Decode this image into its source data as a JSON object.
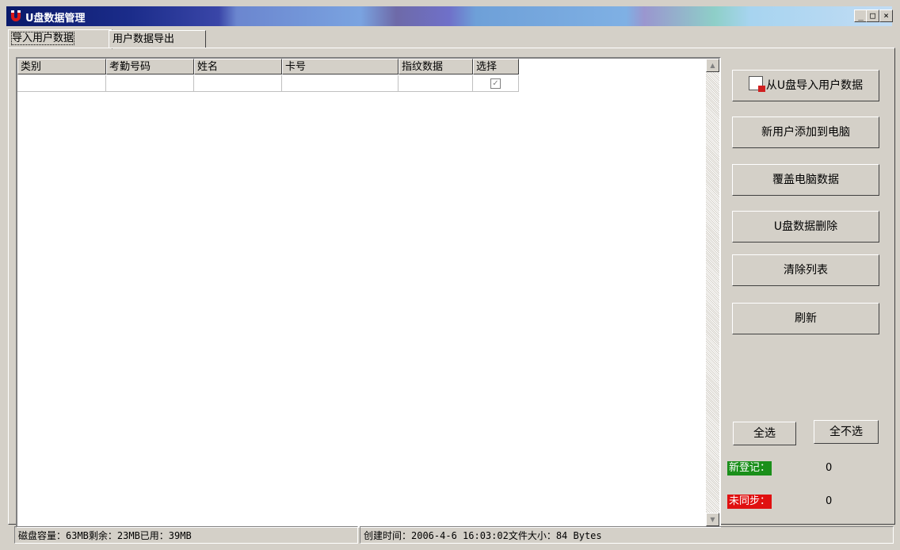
{
  "window": {
    "title": "U盘数据管理",
    "minimize": "_",
    "maximize": "□",
    "close": "×"
  },
  "tabs": [
    {
      "label": "导入用户数据",
      "active": true
    },
    {
      "label": "用户数据导出",
      "active": false
    }
  ],
  "table": {
    "columns": [
      "类别",
      "考勤号码",
      "姓名",
      "卡号",
      "指纹数据",
      "选择"
    ],
    "rows": [
      {
        "category": "",
        "attendance_no": "",
        "name": "",
        "card_no": "",
        "fingerprint": "",
        "selected": true
      }
    ]
  },
  "actions": {
    "import": "从U盘导入用户数据",
    "add_new": "新用户添加到电脑",
    "overwrite": "覆盖电脑数据",
    "delete_u": "U盘数据删除",
    "clear_list": "清除列表",
    "refresh": "刷新"
  },
  "selection": {
    "select_all": "全选",
    "select_none": "全不选"
  },
  "counters": {
    "new_label": "新登记：",
    "new_value": "0",
    "new_color": "#1a8f1a",
    "unsync_label": "未同步：",
    "unsync_value": "0",
    "unsync_color": "#e01010"
  },
  "status": {
    "disk": "磁盘容量：63MB剩余：23MB已用：39MB",
    "file": "创建时间：2006-4-6 16:03:02文件大小：84 Bytes"
  }
}
